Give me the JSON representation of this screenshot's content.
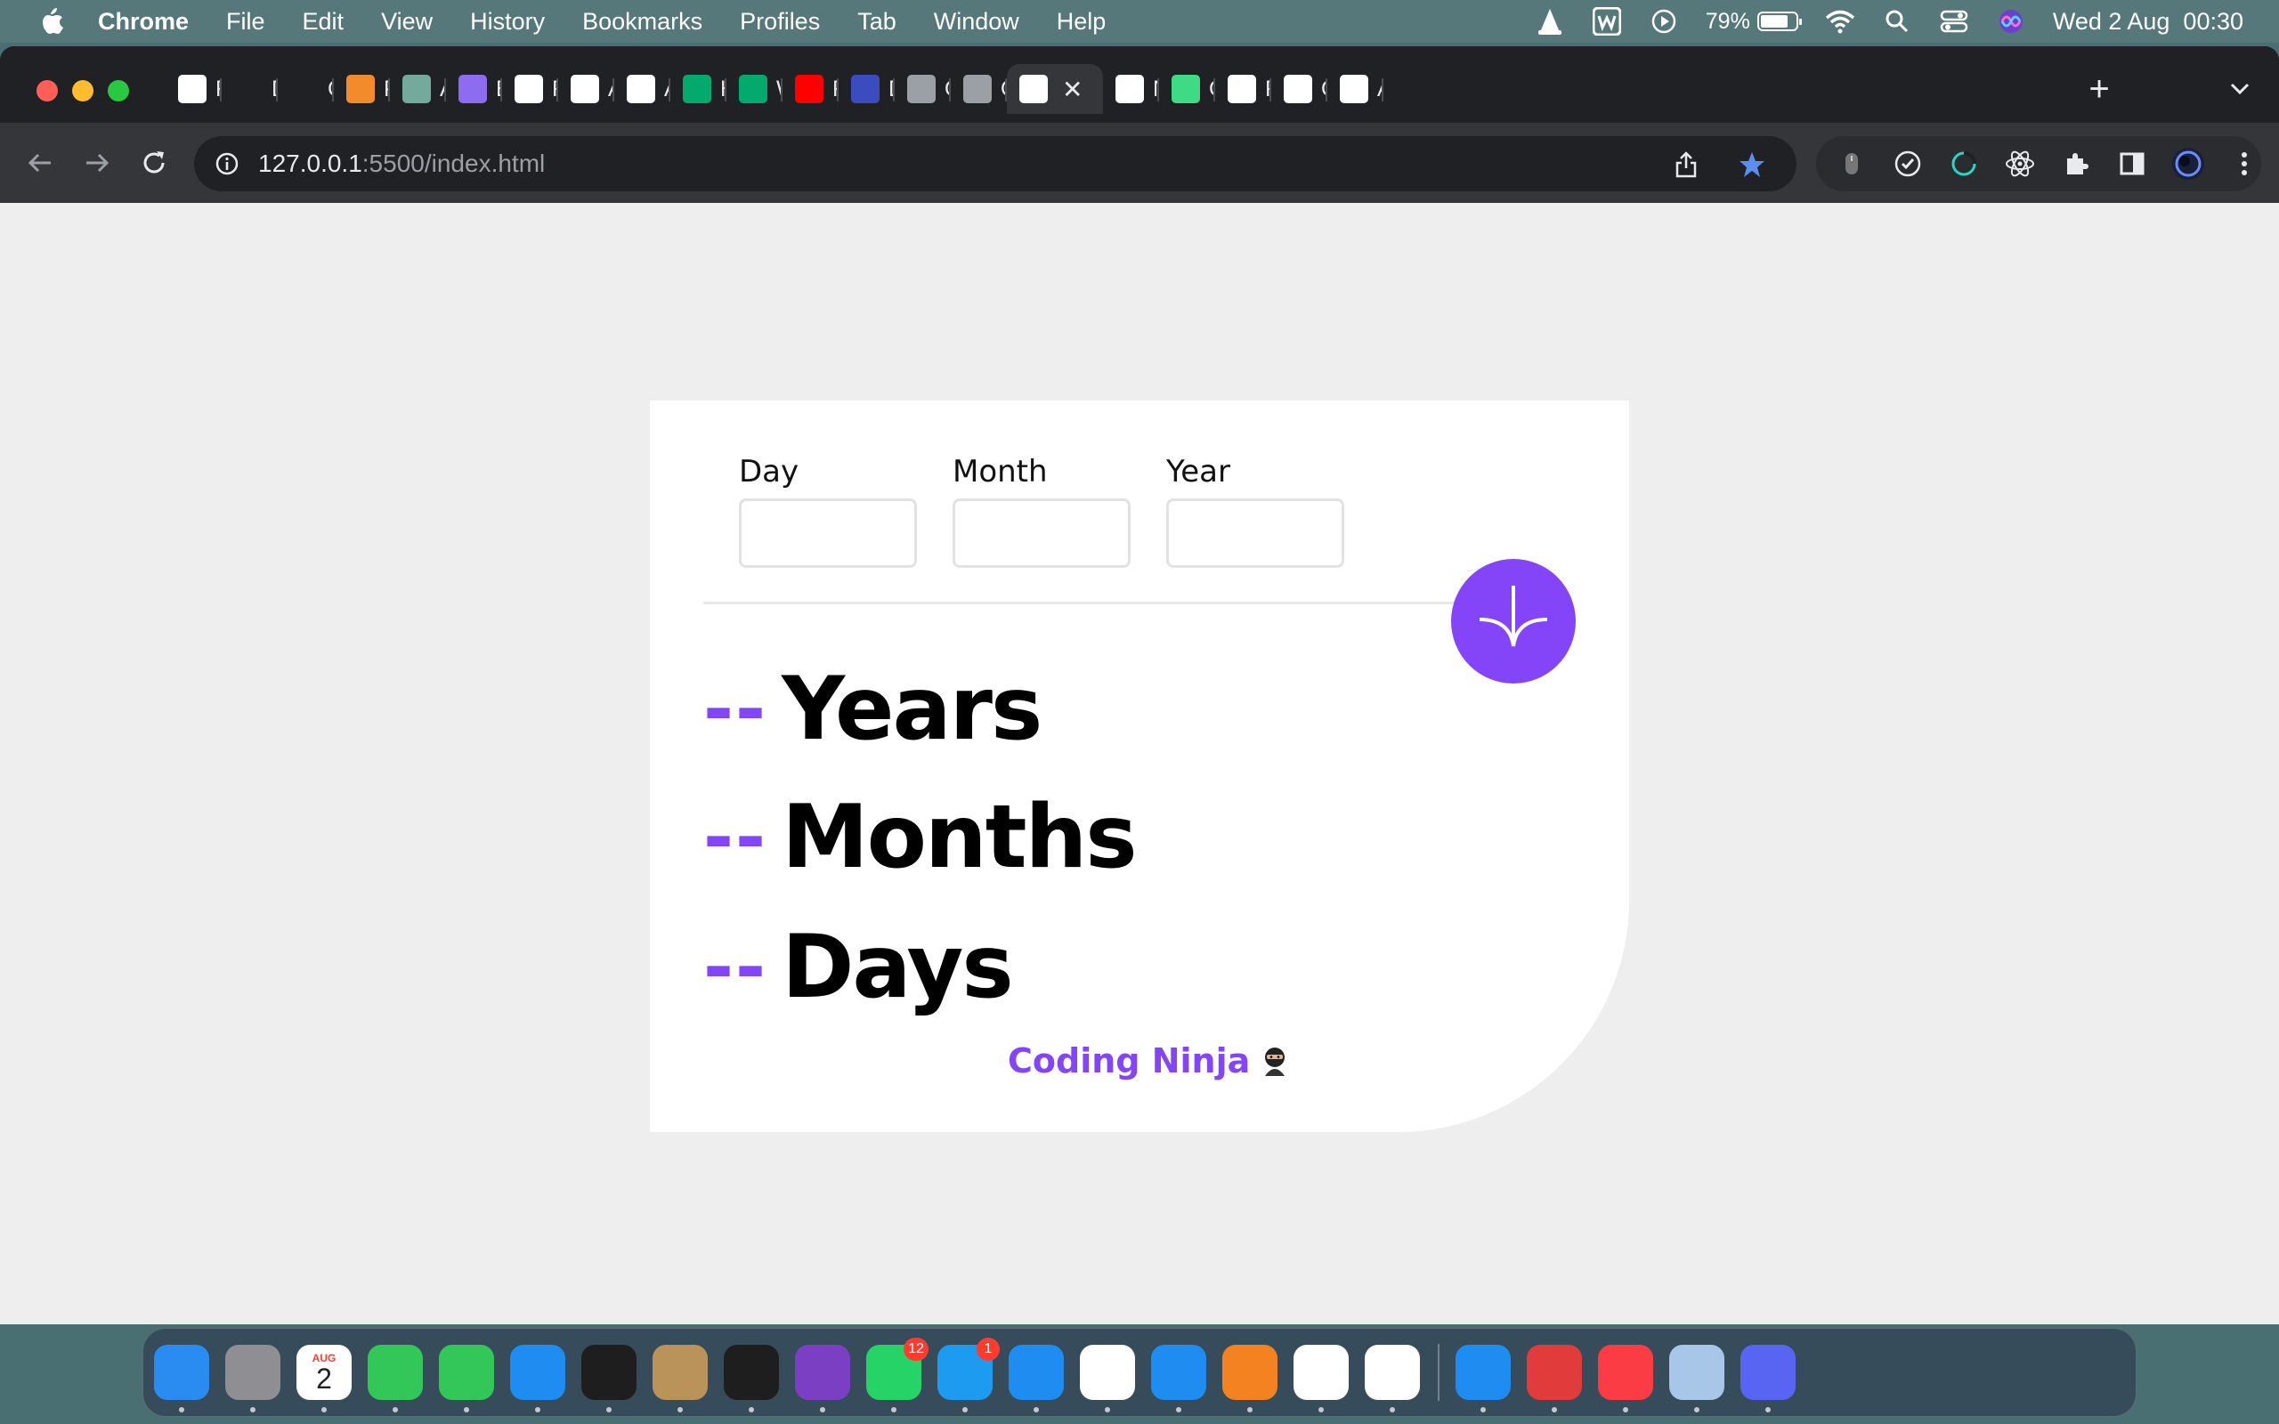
{
  "menubar": {
    "app": "Chrome",
    "items": [
      "File",
      "Edit",
      "View",
      "History",
      "Bookmarks",
      "Profiles",
      "Tab",
      "Window",
      "Help"
    ],
    "battery": "79%",
    "battery_level": 0.79,
    "clock": "Wed 2 Aug  00:30"
  },
  "browser": {
    "tabs": [
      {
        "label": "Fr",
        "icon": "frontend-mentor-icon",
        "color": "#ffffff"
      },
      {
        "label": "Dc",
        "icon": "download-icon",
        "color": "#202124"
      },
      {
        "label": "Cl",
        "icon": "medium-icon",
        "color": "#202124"
      },
      {
        "label": "Pc",
        "icon": "pc-icon",
        "color": "#f28b2c"
      },
      {
        "label": "Ag",
        "icon": "chatgpt-icon",
        "color": "#74aa9c"
      },
      {
        "label": "Ba",
        "icon": "bard-icon",
        "color": "#8e6cf0"
      },
      {
        "label": "Fr",
        "icon": "frontend-mentor-icon",
        "color": "#ffffff"
      },
      {
        "label": "Ag",
        "icon": "age-app-icon",
        "color": "#ffffff"
      },
      {
        "label": "Ag",
        "icon": "age-app-icon",
        "color": "#ffffff"
      },
      {
        "label": "H'",
        "icon": "w3schools-icon",
        "color": "#04aa6d"
      },
      {
        "label": "W",
        "icon": "w3schools-icon",
        "color": "#04aa6d"
      },
      {
        "label": "Fr",
        "icon": "youtube-icon",
        "color": "#ff0000"
      },
      {
        "label": "Dc",
        "icon": "tv-icon",
        "color": "#3b4cc0"
      },
      {
        "label": "Ol",
        "icon": "globe-icon",
        "color": "#9aa0a6"
      },
      {
        "label": "Ol",
        "icon": "globe-icon",
        "color": "#9aa0a6"
      },
      {
        "label": "",
        "icon": "age-app-icon",
        "color": "#ffffff",
        "active": true
      },
      {
        "label": "N",
        "icon": "chrome-icon",
        "color": "#ffffff"
      },
      {
        "label": "O",
        "icon": "leaf-icon",
        "color": "#3ddc84"
      },
      {
        "label": "Fr",
        "icon": "frontend-mentor-icon",
        "color": "#ffffff"
      },
      {
        "label": "O",
        "icon": "github-icon",
        "color": "#ffffff"
      },
      {
        "label": "Ag",
        "icon": "age-app-icon",
        "color": "#ffffff"
      }
    ],
    "url_host": "127.0.0.1",
    "url_rest": ":5500/index.html"
  },
  "page": {
    "labels": {
      "day": "Day",
      "month": "Month",
      "year": "Year"
    },
    "inputs": {
      "day": "",
      "month": "",
      "year": ""
    },
    "results": [
      {
        "value": "--",
        "unit": "Years"
      },
      {
        "value": "--",
        "unit": "Months"
      },
      {
        "value": "--",
        "unit": "Days"
      }
    ],
    "credit": "Coding Ninja",
    "accent": "#8444f8"
  },
  "dock": {
    "apps": [
      {
        "name": "finder-icon",
        "color": "#2a8cf0"
      },
      {
        "name": "launchpad-icon",
        "color": "#8e8e93"
      },
      {
        "name": "calendar-icon",
        "color": "#ffffff",
        "month": "AUG",
        "day": "2"
      },
      {
        "name": "messages-icon",
        "color": "#33c759"
      },
      {
        "name": "facetime-icon",
        "color": "#33c759"
      },
      {
        "name": "mail-icon",
        "color": "#1e8cf0"
      },
      {
        "name": "figma-icon",
        "color": "#1e1e1e"
      },
      {
        "name": "contacts-icon",
        "color": "#b9935a"
      },
      {
        "name": "terminal-icon",
        "color": "#1e1e1e"
      },
      {
        "name": "github-desktop-icon",
        "color": "#7b3fc4"
      },
      {
        "name": "whatsapp-icon",
        "color": "#25d366",
        "badge": "12"
      },
      {
        "name": "twitter-icon",
        "color": "#1d9bf0",
        "badge": "1"
      },
      {
        "name": "safari-icon",
        "color": "#1e8cf0"
      },
      {
        "name": "notion-icon",
        "color": "#ffffff"
      },
      {
        "name": "vscode-icon",
        "color": "#1e8cf0"
      },
      {
        "name": "vlc-icon",
        "color": "#f58220"
      },
      {
        "name": "chrome-icon",
        "color": "#ffffff"
      },
      {
        "name": "slack-icon",
        "color": "#ffffff"
      },
      {
        "name": "bluetooth-icon",
        "color": "#1e8cf0"
      },
      {
        "name": "wps-icon",
        "color": "#e23b3b"
      },
      {
        "name": "music-icon",
        "color": "#fc3c44"
      },
      {
        "name": "preview-icon",
        "color": "#a7c6e8"
      },
      {
        "name": "discord-icon",
        "color": "#5865f2"
      }
    ]
  }
}
